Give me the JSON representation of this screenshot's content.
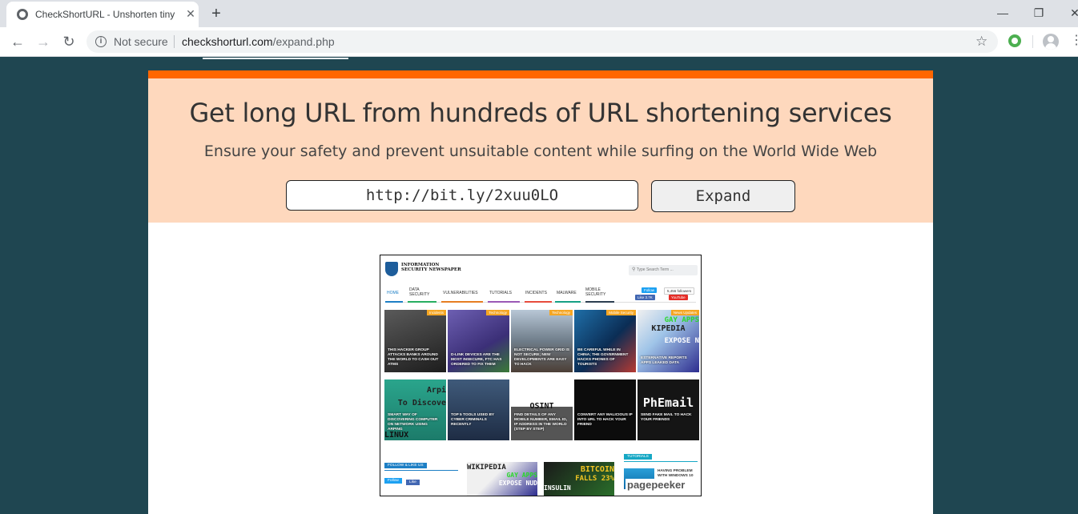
{
  "browser": {
    "tab_title": "CheckShortURL - Unshorten tiny",
    "tab_close": "✕",
    "new_tab": "+",
    "minimize": "—",
    "restore": "❐",
    "close": "✕",
    "security_label": "Not secure",
    "url_host": "checkshorturl.com",
    "url_path": "/expand.php",
    "icons": {
      "back": "back-arrow-icon",
      "forward": "forward-arrow-icon",
      "reload": "reload-icon",
      "info": "info-icon",
      "bookmark": "star-icon",
      "extension": "extension-icon",
      "profile": "avatar-icon",
      "menu": "kebab-menu-icon"
    }
  },
  "hero": {
    "title": "Get long URL from hundreds of URL shortening services",
    "subtitle": "Ensure your safety and prevent unsuitable content while surfing on the World Wide Web",
    "url_value": "http://bit.ly/2xuu0LO",
    "expand_label": "Expand"
  },
  "colors": {
    "page_bg": "#1f4651",
    "accent_bar": "#ff6600",
    "hero_bg": "#fed8bd"
  },
  "preview": {
    "brand": "INFORMATION SECURITY NEWSPAPER",
    "search_placeholder": "Type Search Term ...",
    "nav": [
      "HOME",
      "DATA SECURITY",
      "VULNERABILITIES",
      "TUTORIALS",
      "INCIDENTS",
      "MALWARE",
      "MOBILE SECURITY"
    ],
    "follow": "Follow",
    "followers": "5,456 followers",
    "like": "Like 3.7K",
    "youtube": "YouTube",
    "row1": [
      {
        "caption": "THIS HACKER GROUP ATTACKS BANKS AROUND THE WORLD TO CASH OUT ATMS",
        "tag": "Incidents"
      },
      {
        "caption": "D-LINK DEVICES ARE THE MOST INSECURE, FTC HAS ORDERED TO FIX THEM",
        "tag": "Technology"
      },
      {
        "caption": "ELECTRICAL POWER GRID IS NOT SECURE; NEW DEVELOPMENTS ARE EASY TO HACK",
        "tag": "Technology"
      },
      {
        "caption": "BE CAREFUL WHILE IN CHINA; THE GOVERNMENT HACKS PHONES OF TOURISTS",
        "tag": "Mobile Security"
      },
      {
        "caption": "ESTERNATIVE REPORTS APPS LEAKED DATA",
        "tag": "News Updates"
      }
    ],
    "row2": [
      {
        "caption": "SMART WAY OF DISCOVERING COMPUTER ON NETWORK USING ARPING",
        "big": "Arpi"
      },
      {
        "caption": "TOP 5 TOOLS USED BY CYBER CRIMINALS RECENTLY",
        "big": ""
      },
      {
        "caption": "FIND DETAILS OF ANY MOBILE NUMBER, EMAIL ID, IP ADDRESS IN THE WORLD (STEP BY STEP)",
        "big": "OSINT"
      },
      {
        "caption": "CONVERT ANY MALICIOUS IP INTO URL TO HACK YOUR FRIEND",
        "big": ""
      },
      {
        "caption": "SEND FAKE MAIL TO HACK YOUR FRIENDS",
        "big": "PhEmail"
      }
    ],
    "row1_art": [
      "",
      "",
      "",
      "",
      "KIPEDIA"
    ],
    "row1_art2": [
      "",
      "",
      "",
      "",
      "GAY APPS"
    ],
    "row1_art3": [
      "",
      "",
      "",
      "",
      "EXPOSE N"
    ],
    "row2_sub": "To Discove",
    "row2_sub2": "LINUX",
    "follow_heading": "FOLLOW & LIKE US",
    "follow_btn": "Follow",
    "like_btn": "Like",
    "bottom1_art": "WIKIPEDIA",
    "bottom1_art2": "GAY APPS",
    "bottom1_art3": "EXPOSE NUD",
    "bottom2_art": "BITCOIN",
    "bottom2_art2": "FALLS 23%",
    "bottom2_art3": "INSULIN",
    "tutorials_label": "TUTORIALS",
    "tutorial_caption": "HAVING PROBLEM WITH WINDOWS 10",
    "pagepeeker": "pagepeeker"
  }
}
